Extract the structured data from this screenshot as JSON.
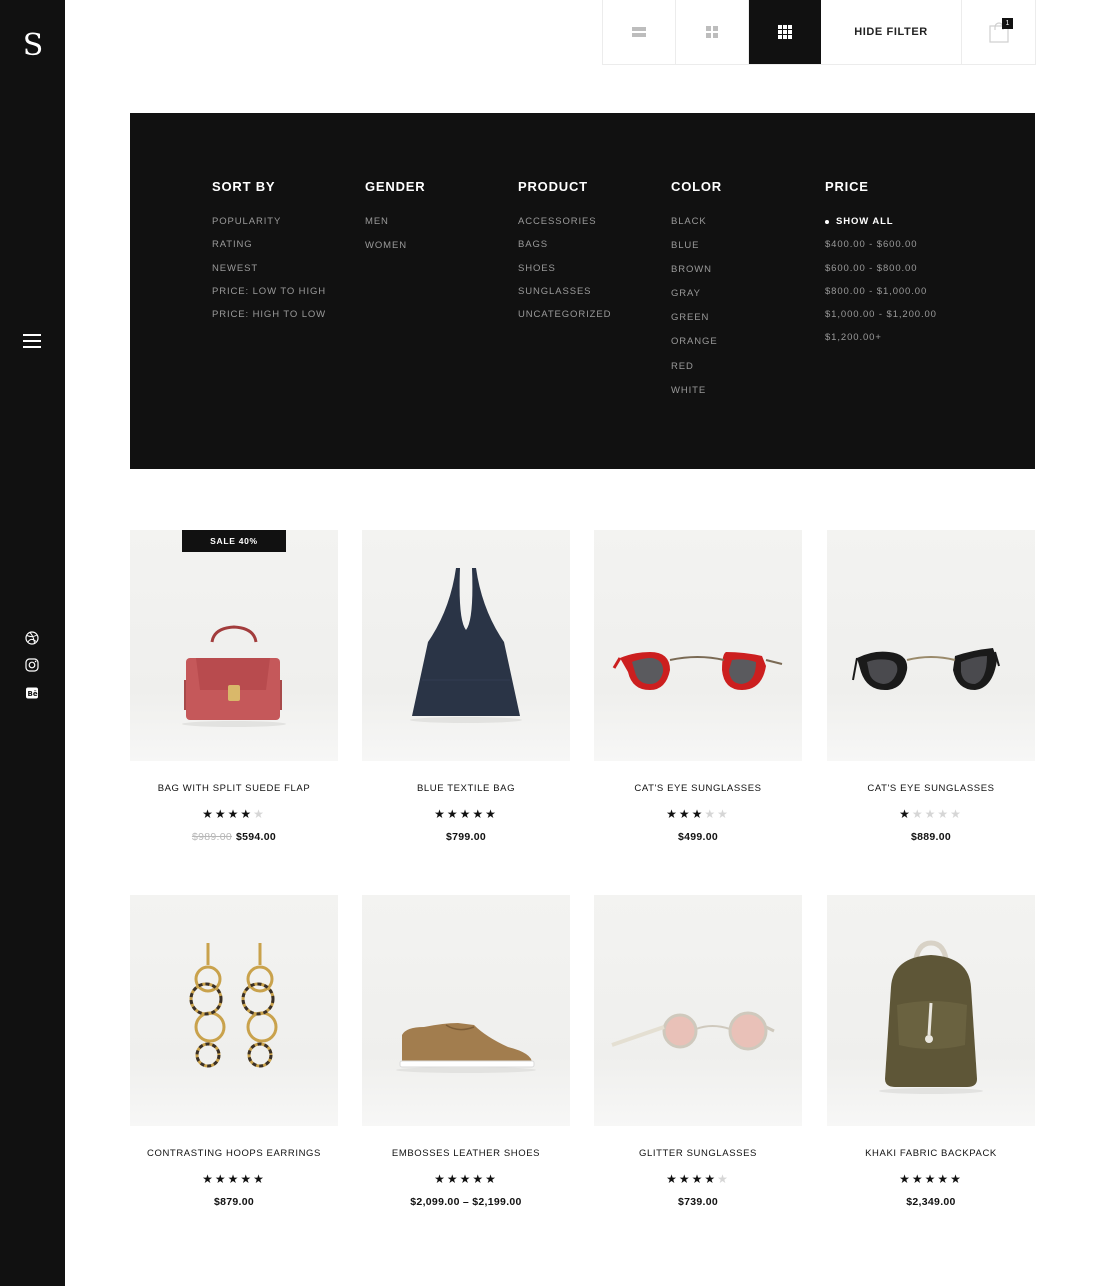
{
  "sidebar": {
    "logo_text": "S",
    "menu_icon": "hamburger-icon",
    "social_icons": [
      "dribbble-icon",
      "instagram-icon",
      "behance-icon"
    ]
  },
  "toolbar": {
    "view_buttons": [
      "list-view-icon",
      "grid-4-view-icon",
      "grid-9-view-icon"
    ],
    "active_view": "grid-9-view-icon",
    "hide_filter_label": "HIDE FILTER",
    "cart_count": "1"
  },
  "filters": {
    "sort_by": {
      "title": "SORT BY",
      "options": [
        "POPULARITY",
        "RATING",
        "NEWEST",
        "PRICE: LOW TO HIGH",
        "PRICE: HIGH TO LOW"
      ]
    },
    "gender": {
      "title": "GENDER",
      "options": [
        "MEN",
        "WOMEN"
      ]
    },
    "product": {
      "title": "PRODUCT",
      "options": [
        "ACCESSORIES",
        "BAGS",
        "SHOES",
        "SUNGLASSES",
        "UNCATEGORIZED"
      ]
    },
    "color": {
      "title": "COLOR",
      "options": [
        "BLACK",
        "BLUE",
        "BROWN",
        "GRAY",
        "GREEN",
        "ORANGE",
        "RED",
        "WHITE"
      ]
    },
    "price": {
      "title": "PRICE",
      "options": [
        "SHOW ALL",
        "$400.00 - $600.00",
        "$600.00 - $800.00",
        "$800.00 - $1,000.00",
        "$1,000.00 - $1,200.00",
        "$1,200.00+"
      ],
      "selected": "SHOW ALL"
    }
  },
  "products": [
    {
      "name": "BAG WITH SPLIT SUEDE FLAP",
      "rating": 4,
      "old_price": "$989.00",
      "price": "$594.00",
      "badge": "SALE 40%"
    },
    {
      "name": "BLUE TEXTILE BAG",
      "rating": 5,
      "price": "$799.00"
    },
    {
      "name": "CAT'S EYE SUNGLASSES",
      "rating": 3,
      "price": "$499.00"
    },
    {
      "name": "CAT'S EYE SUNGLASSES",
      "rating": 1,
      "price": "$889.00"
    },
    {
      "name": "CONTRASTING HOOPS EARRINGS",
      "rating": 5,
      "price": "$879.00"
    },
    {
      "name": "EMBOSSES LEATHER SHOES",
      "rating": 5,
      "price": "$2,099.00 – $2,199.00"
    },
    {
      "name": "GLITTER SUNGLASSES",
      "rating": 4,
      "price": "$739.00"
    },
    {
      "name": "KHAKI FABRIC BACKPACK",
      "rating": 5,
      "price": "$2,349.00"
    }
  ],
  "colors": {
    "sidebar_bg": "#111111",
    "filter_bg": "#111111",
    "text_muted": "#9a9a9a",
    "star_on": "#111111",
    "star_off": "#d6d6d6"
  }
}
